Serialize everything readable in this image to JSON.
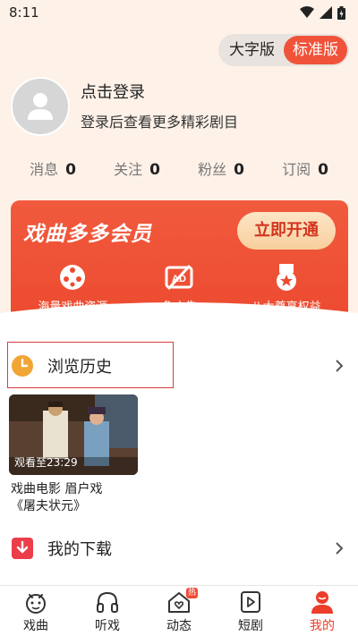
{
  "status": {
    "time": "8:11"
  },
  "toggle": {
    "large_label": "大字版",
    "standard_label": "标准版"
  },
  "profile": {
    "login_title": "点击登录",
    "login_sub": "登录后查看更多精彩剧目"
  },
  "stats": [
    {
      "label": "消息",
      "value": "0"
    },
    {
      "label": "关注",
      "value": "0"
    },
    {
      "label": "粉丝",
      "value": "0"
    },
    {
      "label": "订阅",
      "value": "0"
    }
  ],
  "vip": {
    "title": "戏曲多多会员",
    "button": "立即开通",
    "features": [
      "海量戏曲资源",
      "免广告",
      "八大尊享权益"
    ]
  },
  "history": {
    "label": "浏览历史",
    "item": {
      "caption": "观看至23:29",
      "title_line1": "戏曲电影 眉户戏",
      "title_line2": "《屠夫状元》"
    }
  },
  "downloads": {
    "label": "我的下载"
  },
  "nav": {
    "items": [
      "戏曲",
      "听戏",
      "动态",
      "短剧",
      "我的"
    ],
    "hot_badge": "热"
  },
  "colors": {
    "accent": "#ec3d2a",
    "page_bg": "#fdf1e8",
    "history_icon": "#f1a534"
  }
}
